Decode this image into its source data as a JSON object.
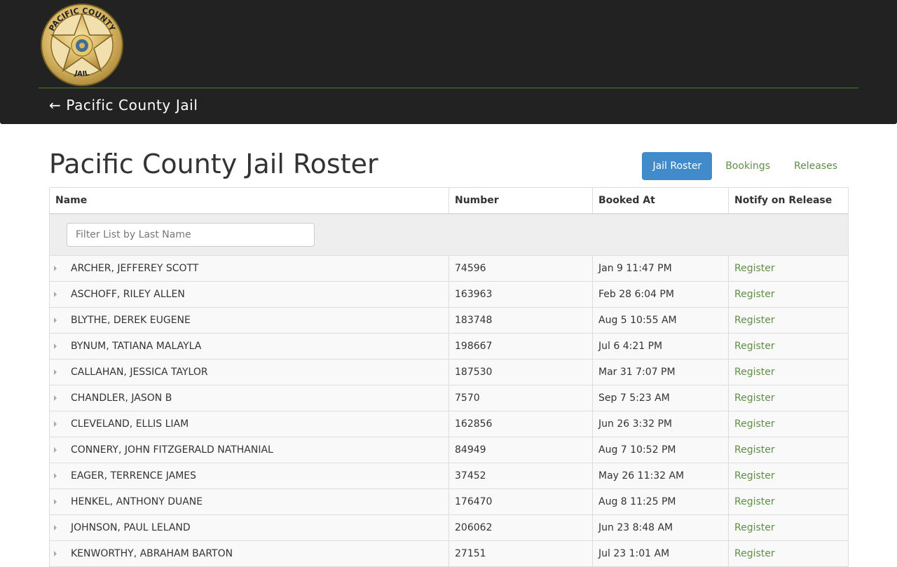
{
  "header": {
    "logo": {
      "top_text": "PACIFIC COUNTY",
      "bottom_text": "JAIL",
      "color": "#c9a24a"
    },
    "back_link": "← Pacific County Jail",
    "rule_color": "#4f7f3a"
  },
  "page": {
    "title": "Pacific County Jail Roster"
  },
  "nav": {
    "tabs": [
      {
        "label": "Jail Roster",
        "active": true
      },
      {
        "label": "Bookings",
        "active": false
      },
      {
        "label": "Releases",
        "active": false
      }
    ],
    "active_color": "#428bca",
    "link_color": "#5f8f46"
  },
  "table": {
    "columns": [
      "Name",
      "Number",
      "Booked At",
      "Notify on Release"
    ],
    "filter_placeholder": "Filter List by Last Name",
    "rows": [
      {
        "name": "ARCHER, JEFFEREY SCOTT",
        "number": "74596",
        "booked_at": "Jan 9 11:47 PM",
        "action": "Register"
      },
      {
        "name": "ASCHOFF, RILEY ALLEN",
        "number": "163963",
        "booked_at": "Feb 28 6:04 PM",
        "action": "Register"
      },
      {
        "name": "BLYTHE, DEREK EUGENE",
        "number": "183748",
        "booked_at": "Aug 5 10:55 AM",
        "action": "Register"
      },
      {
        "name": "BYNUM, TATIANA MALAYLA",
        "number": "198667",
        "booked_at": "Jul 6 4:21 PM",
        "action": "Register"
      },
      {
        "name": "CALLAHAN, JESSICA TAYLOR",
        "number": "187530",
        "booked_at": "Mar 31 7:07 PM",
        "action": "Register"
      },
      {
        "name": "CHANDLER, JASON B",
        "number": "7570",
        "booked_at": "Sep 7 5:23 AM",
        "action": "Register"
      },
      {
        "name": "CLEVELAND, ELLIS LIAM",
        "number": "162856",
        "booked_at": "Jun 26 3:32 PM",
        "action": "Register"
      },
      {
        "name": "CONNERY, JOHN FITZGERALD NATHANIAL",
        "number": "84949",
        "booked_at": "Aug 7 10:52 PM",
        "action": "Register"
      },
      {
        "name": "EAGER, TERRENCE JAMES",
        "number": "37452",
        "booked_at": "May 26 11:32 AM",
        "action": "Register"
      },
      {
        "name": "HENKEL, ANTHONY DUANE",
        "number": "176470",
        "booked_at": "Aug 8 11:25 PM",
        "action": "Register"
      },
      {
        "name": "JOHNSON, PAUL LELAND",
        "number": "206062",
        "booked_at": "Jun 23 8:48 AM",
        "action": "Register"
      },
      {
        "name": "KENWORTHY, ABRAHAM BARTON",
        "number": "27151",
        "booked_at": "Jul 23 1:01 AM",
        "action": "Register"
      }
    ]
  }
}
